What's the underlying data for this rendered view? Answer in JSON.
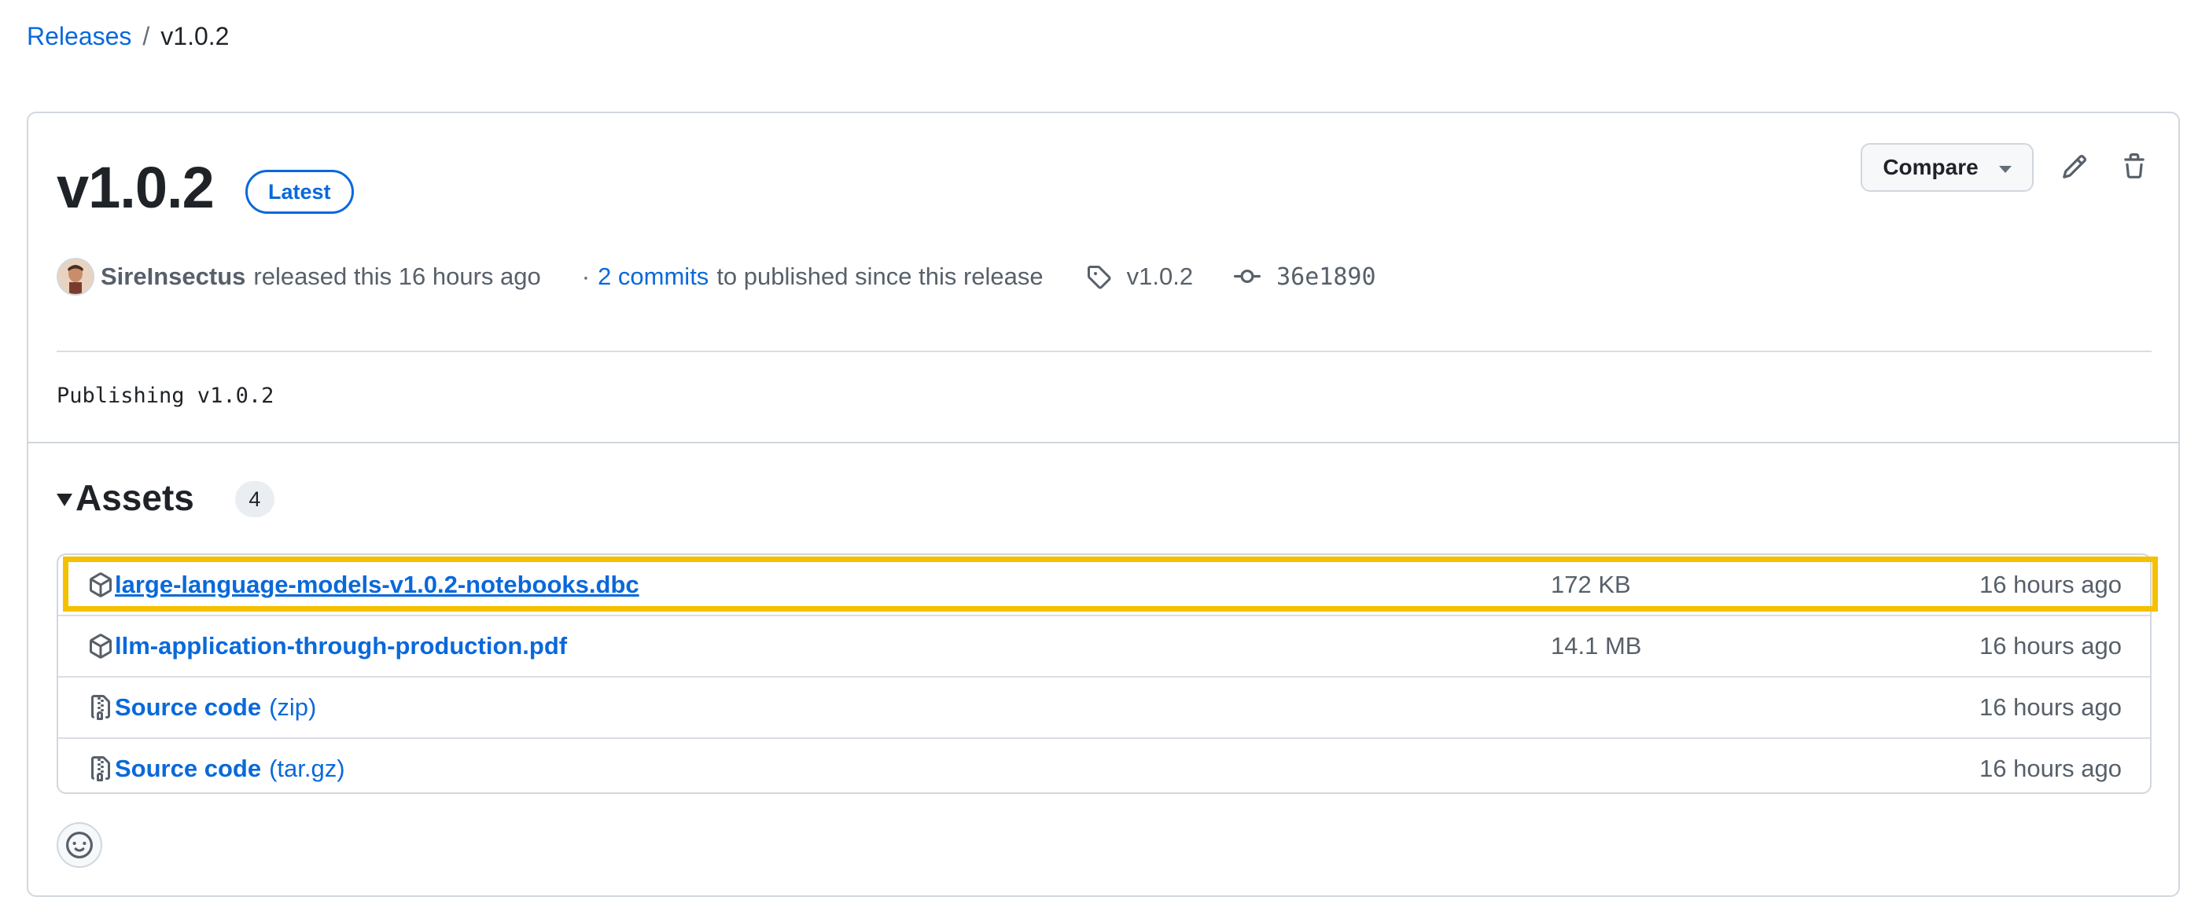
{
  "breadcrumb": {
    "parent": "Releases",
    "separator": "/",
    "current": "v1.0.2"
  },
  "release": {
    "title": "v1.0.2",
    "badge": "Latest",
    "compare_label": "Compare",
    "author": "SireInsectus",
    "released_text": "released this 16 hours ago",
    "dot": "·",
    "commits_link": "2 commits",
    "published_text": "to published since this release",
    "tag": "v1.0.2",
    "commit_sha": "36e1890",
    "body": "Publishing v1.0.2"
  },
  "assets": {
    "title": "Assets",
    "count": "4",
    "items": [
      {
        "name": "large-language-models-v1.0.2-notebooks.dbc",
        "suffix": "",
        "size": "172 KB",
        "time": "16 hours ago",
        "icon": "package-icon"
      },
      {
        "name": "llm-application-through-production.pdf",
        "suffix": "",
        "size": "14.1 MB",
        "time": "16 hours ago",
        "icon": "package-icon"
      },
      {
        "name": "Source code",
        "suffix": "(zip)",
        "size": "",
        "time": "16 hours ago",
        "icon": "file-zip-icon"
      },
      {
        "name": "Source code",
        "suffix": "(tar.gz)",
        "size": "",
        "time": "16 hours ago",
        "icon": "file-zip-icon"
      }
    ]
  },
  "colors": {
    "link": "#0969da",
    "highlight": "#f5c000",
    "border": "#d0d7de",
    "muted": "#57606a"
  }
}
